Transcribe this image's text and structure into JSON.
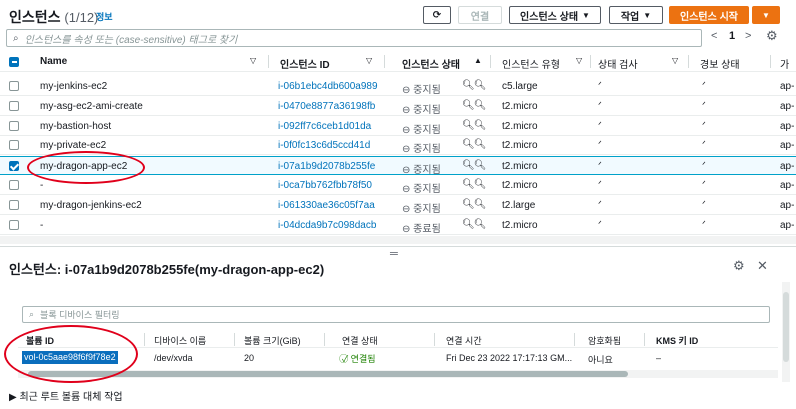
{
  "header": {
    "title": "인스턴스",
    "count": "(1/12)",
    "info": "정보",
    "refresh_icon": "refresh-icon",
    "connect": "연결",
    "instance_state": "인스턴스 상태",
    "actions": "작업",
    "launch": "인스턴스 시작"
  },
  "search": {
    "placeholder": "인스턴스를 속성 또는 (case-sensitive) 태그로 찾기"
  },
  "pager": {
    "prev": "<",
    "page": "1",
    "next": ">"
  },
  "columns": [
    "Name",
    "인스턴스 ID",
    "인스턴스 상태",
    "인스턴스 유형",
    "상태 검사",
    "경보 상태",
    "가"
  ],
  "instances": [
    {
      "name": "my-jenkins-ec2",
      "id": "i-06b1ebc4db600a989",
      "state": "중지됨",
      "type": "c5.large",
      "az": "ap-"
    },
    {
      "name": "my-asg-ec2-ami-create",
      "id": "i-0470e8877a36198fb",
      "state": "중지됨",
      "type": "t2.micro",
      "az": "ap-"
    },
    {
      "name": "my-bastion-host",
      "id": "i-092ff7c6ceb1d01da",
      "state": "중지됨",
      "type": "t2.micro",
      "az": "ap-"
    },
    {
      "name": "my-private-ec2",
      "id": "i-0f0fc13c6d5ccd41d",
      "state": "중지됨",
      "type": "t2.micro",
      "az": "ap-"
    },
    {
      "name": "my-dragon-app-ec2",
      "id": "i-07a1b9d2078b255fe",
      "state": "중지됨",
      "type": "t2.micro",
      "az": "ap-"
    },
    {
      "name": "-",
      "id": "i-0ca7bb762fbb78f50",
      "state": "중지됨",
      "type": "t2.micro",
      "az": "ap-"
    },
    {
      "name": "my-dragon-jenkins-ec2",
      "id": "i-061330ae36c05f7aa",
      "state": "중지됨",
      "type": "t2.large",
      "az": "ap-"
    },
    {
      "name": "-",
      "id": "i-04dcda9b7c098dacb",
      "state": "종료됨",
      "type": "t2.micro",
      "az": "ap-"
    }
  ],
  "detail": {
    "title": "인스턴스: i-07a1b9d2078b255fe(my-dragon-app-ec2)",
    "filter_placeholder": "블록 디바이스 필터링",
    "volume_columns": [
      "볼륨 ID",
      "디바이스 이름",
      "볼륨 크기(GiB)",
      "연결 상태",
      "연결 시간",
      "암호화됨",
      "KMS 키 ID"
    ],
    "volume": {
      "id": "vol-0c5aae98f6f9f78e2",
      "device": "/dev/xvda",
      "size": "20",
      "state": "연결됨",
      "time": "Fri Dec 23 2022 17:17:13 GM...",
      "encrypted": "아니요",
      "kms": "–"
    },
    "section": "최근 루트 볼륨 대체 작업"
  },
  "colors": {
    "accent": "#ec7211",
    "link": "#0073bb",
    "annotation": "#e0001b"
  }
}
